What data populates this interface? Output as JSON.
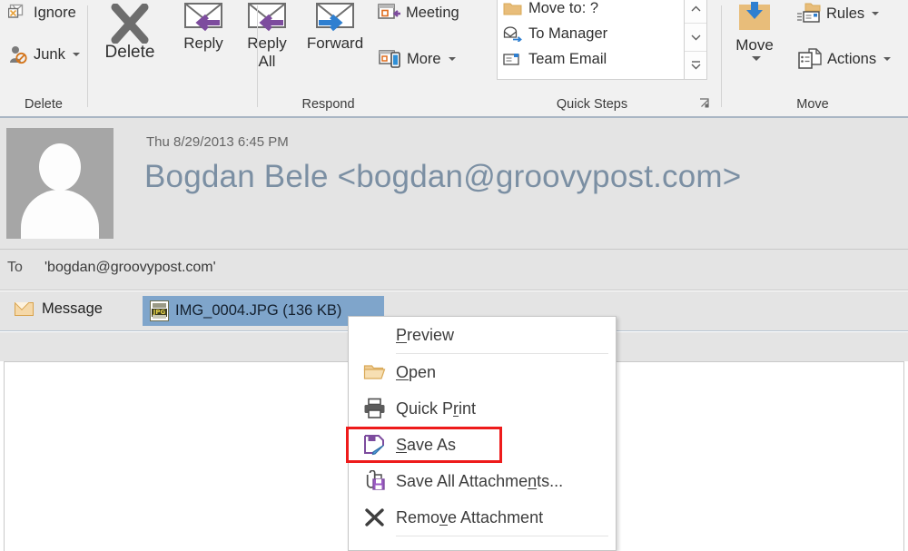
{
  "ribbon": {
    "groups": [
      {
        "label": "Delete"
      },
      {
        "label": "Respond"
      },
      {
        "label": "Quick Steps"
      },
      {
        "label": "Move"
      }
    ],
    "delete": {
      "ignore_label": "Ignore",
      "junk_label": "Junk",
      "delete_label": "Delete"
    },
    "respond": {
      "reply_label": "Reply",
      "reply_all_label_line1": "Reply",
      "reply_all_label_line2": "All",
      "forward_label": "Forward",
      "meeting_label": "Meeting",
      "more_label": "More"
    },
    "quick_steps": {
      "items": [
        {
          "label": "Move to: ?",
          "icon": "folder-icon"
        },
        {
          "label": "To Manager",
          "icon": "forward-envelope-icon"
        },
        {
          "label": "Team Email",
          "icon": "team-email-icon"
        }
      ],
      "scroll_up": "▲",
      "scroll_down": "▼",
      "scroll_more": "☰",
      "dialog_launcher": "⤡"
    },
    "move": {
      "move_label": "Move",
      "rules_label": "Rules",
      "actions_label": "Actions"
    }
  },
  "message": {
    "date": "Thu 8/29/2013 6:45 PM",
    "from": "Bogdan Bele <bogdan@groovypost.com>",
    "to_label": "To",
    "to_value": "'bogdan@groovypost.com'",
    "message_tab_label": "Message",
    "attachment": {
      "filename": "IMG_0004.JPG",
      "size": "(136 KB)",
      "display": "IMG_0004.JPG (136 KB)",
      "type_label": "JPG",
      "selected": true
    }
  },
  "context_menu": {
    "items": [
      {
        "label": "Preview",
        "accel": "P",
        "icon": "none",
        "highlighted": false
      },
      {
        "label": "Open",
        "accel": "O",
        "icon": "folder-open-icon",
        "highlighted": false
      },
      {
        "label": "Quick Print",
        "accel": "r",
        "icon": "printer-icon",
        "highlighted": false
      },
      {
        "label": "Save As",
        "accel": "S",
        "icon": "save-as-icon",
        "highlighted": true
      },
      {
        "label": "Save All Attachments...",
        "accel": "n",
        "icon": "save-all-attachments-icon",
        "highlighted": false
      },
      {
        "label": "Remove Attachment",
        "accel": "v",
        "icon": "remove-attachment-icon",
        "highlighted": false
      }
    ]
  },
  "colors": {
    "ribbon_bg": "#f1f1f1",
    "header_bg": "#e4e4e4",
    "accent_purple": "#7d4c9e",
    "accent_blue": "#2f7fd0",
    "folder_tan": "#e8bd7a",
    "selection_blue": "#7fa5cb",
    "highlight_red": "#ee1b1b",
    "from_text": "#7b8fa3"
  }
}
